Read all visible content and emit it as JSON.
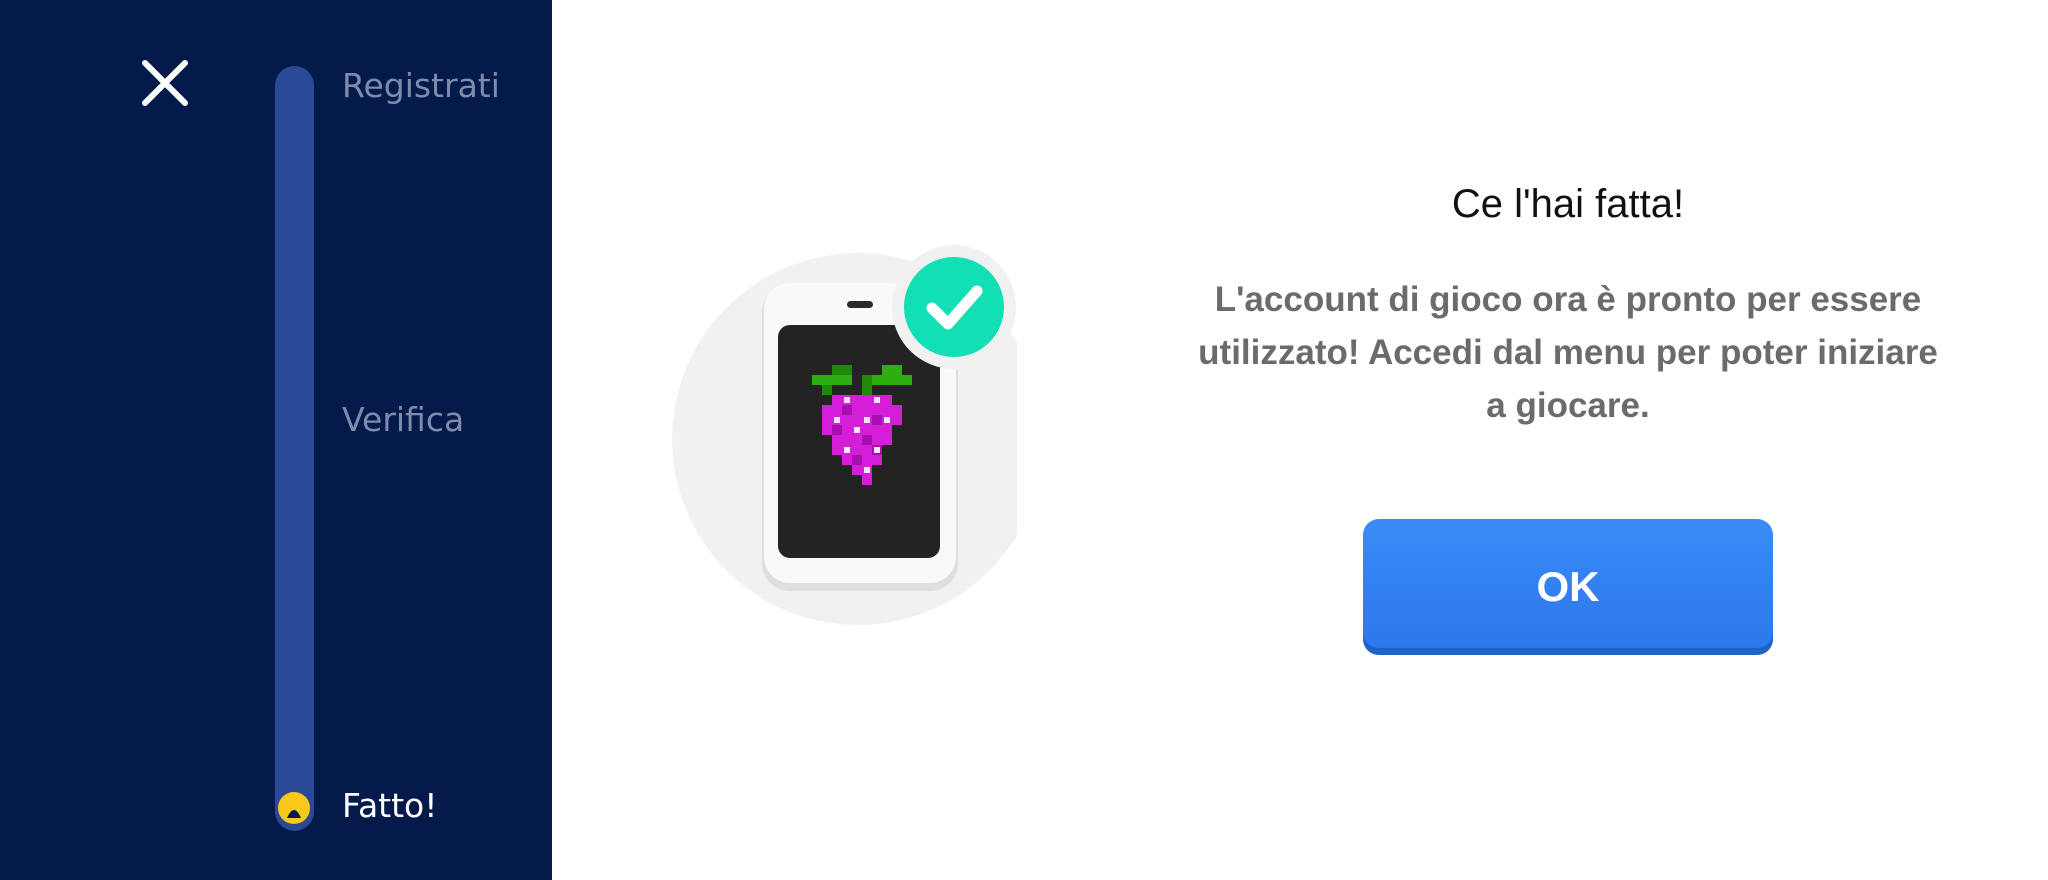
{
  "sidebar": {
    "close_icon": "close-icon",
    "steps": [
      {
        "label": "Registrati",
        "state": "completed"
      },
      {
        "label": "Verifica",
        "state": "completed"
      },
      {
        "label": "Fatto!",
        "state": "current"
      }
    ],
    "progress_indicator_icon": "progress-dot-icon"
  },
  "illustration": {
    "device_icon": "smartphone-icon",
    "screen_icon": "grapes-icon",
    "badge_icon": "checkmark-icon"
  },
  "dialog": {
    "title": "Ce l'hai fatta!",
    "message": "L'account di gioco ora è pronto per essere utilizzato! Accedi dal menu per poter iniziare a giocare.",
    "ok_label": "OK"
  },
  "colors": {
    "sidebar_bg": "#031a4a",
    "progress_track": "#2a4a97",
    "progress_dot": "#f8c91a",
    "ok_button": "#3a8af7",
    "check_badge": "#12dfb4",
    "grapes": "#d51ed8"
  }
}
